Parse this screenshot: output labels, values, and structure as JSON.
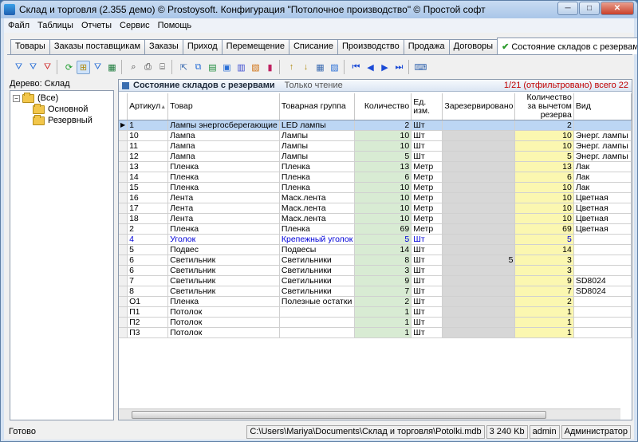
{
  "window": {
    "title": "Склад и торговля (2.355 демо) © Prostoysoft. Конфигурация \"Потолочное производство\" © Простой софт",
    "btn_min": "─",
    "btn_max": "□",
    "btn_close": "✕"
  },
  "menu": [
    {
      "label": "Файл",
      "key": "Ф"
    },
    {
      "label": "Таблицы",
      "key": "Т"
    },
    {
      "label": "Отчеты",
      "key": ""
    },
    {
      "label": "Сервис",
      "key": "С"
    },
    {
      "label": "Помощь",
      "key": "П"
    }
  ],
  "tabs": [
    "Товары",
    "Заказы поставщикам",
    "Заказы",
    "Приход",
    "Перемещение",
    "Списание",
    "Производство",
    "Продажа",
    "Договоры"
  ],
  "active_tab": {
    "check": "✔",
    "label": "Состояние складов с резервами"
  },
  "tree": {
    "header": "Дерево: Склад",
    "toggle": "−",
    "root": "(Все)",
    "children": [
      "Основной",
      "Резервный"
    ]
  },
  "grid": {
    "title": "Состояние складов с резервами",
    "readonly": "Только чтение",
    "counter": "1/21 (отфильтровано) всего 22",
    "columns": [
      "Артикул",
      "Товар",
      "Товарная группа",
      "Количество",
      "Ед. изм.",
      "Зарезервировано",
      "Количество за вычетом резерва",
      "Вид"
    ],
    "sort_marker": "▲",
    "rows": [
      [
        "1",
        "Лампы энергосберегающие",
        "LED лампы",
        "2",
        "Шт",
        "",
        "2",
        ""
      ],
      [
        "10",
        "Лампа",
        "Лампы",
        "10",
        "Шт",
        "",
        "10",
        "Энерг. лампы"
      ],
      [
        "11",
        "Лампа",
        "Лампы",
        "10",
        "Шт",
        "",
        "10",
        "Энерг. лампы"
      ],
      [
        "12",
        "Лампа",
        "Лампы",
        "5",
        "Шт",
        "",
        "5",
        "Энерг. лампы"
      ],
      [
        "13",
        "Пленка",
        "Пленка",
        "13",
        "Метр",
        "",
        "13",
        "Лак"
      ],
      [
        "14",
        "Пленка",
        "Пленка",
        "6",
        "Метр",
        "",
        "6",
        "Лак"
      ],
      [
        "15",
        "Пленка",
        "Пленка",
        "10",
        "Метр",
        "",
        "10",
        "Лак"
      ],
      [
        "16",
        "Лента",
        "Маск.лента",
        "10",
        "Метр",
        "",
        "10",
        "Цветная"
      ],
      [
        "17",
        "Лента",
        "Маск.лента",
        "10",
        "Метр",
        "",
        "10",
        "Цветная"
      ],
      [
        "18",
        "Лента",
        "Маск.лента",
        "10",
        "Метр",
        "",
        "10",
        "Цветная"
      ],
      [
        "2",
        "Пленка",
        "Пленка",
        "69",
        "Метр",
        "",
        "69",
        "Цветная"
      ],
      [
        "4",
        "Уголок",
        "Крепежный уголок",
        "5",
        "Шт",
        "",
        "5",
        ""
      ],
      [
        "5",
        "Подвес",
        "Подвесы",
        "14",
        "Шт",
        "",
        "14",
        ""
      ],
      [
        "6",
        "Светильник",
        "Светильники",
        "8",
        "Шт",
        "5",
        "3",
        ""
      ],
      [
        "6",
        "Светильник",
        "Светильники",
        "3",
        "Шт",
        "",
        "3",
        ""
      ],
      [
        "7",
        "Светильник",
        "Светильники",
        "9",
        "Шт",
        "",
        "9",
        "SD8024"
      ],
      [
        "8",
        "Светильник",
        "Светильники",
        "7",
        "Шт",
        "",
        "7",
        "SD8024"
      ],
      [
        "О1",
        "Пленка",
        "Полезные остатки",
        "2",
        "Шт",
        "",
        "2",
        ""
      ],
      [
        "П1",
        "Потолок",
        "",
        "1",
        "Шт",
        "",
        "1",
        ""
      ],
      [
        "П2",
        "Потолок",
        "",
        "1",
        "Шт",
        "",
        "1",
        ""
      ],
      [
        "П3",
        "Потолок",
        "",
        "1",
        "Шт",
        "",
        "1",
        ""
      ]
    ],
    "selected_row": 0,
    "blue_row": 11,
    "row_indicator": "▶"
  },
  "status": {
    "left": "Готово",
    "path": "C:\\Users\\Mariya\\Documents\\Склад и торговля\\Potolki.mdb",
    "size": "3 240 Kb",
    "user": "admin",
    "role": "Администратор"
  },
  "toolbar_icons": [
    "filter-icon",
    "filter-add-icon",
    "filter-clear-icon",
    "refresh-icon",
    "tree-toggle-icon",
    "filter-tree-icon",
    "columns-icon",
    "find-icon",
    "print-icon",
    "preview-icon",
    "export-icon",
    "copy-icon",
    "export-excel-icon",
    "export-xml-icon",
    "export-word-icon",
    "export-html-icon",
    "chart-icon",
    "sort-asc-icon",
    "sort-desc-icon",
    "grid-settings-icon",
    "save-layout-icon",
    "first-icon",
    "prev-icon",
    "next-icon",
    "last-icon",
    "keyboard-icon"
  ]
}
